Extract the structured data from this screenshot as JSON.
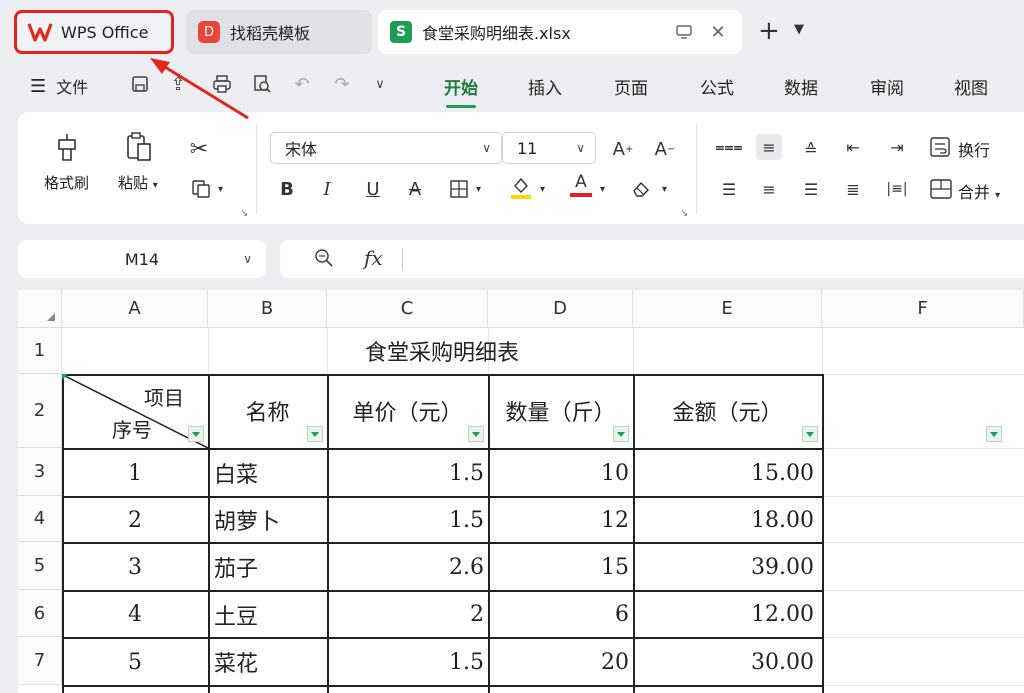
{
  "tabs": {
    "wps": "WPS Office",
    "template": "找稻壳模板",
    "document": "食堂采购明细表.xlsx",
    "template_icon_glyph": "D",
    "sheet_icon_glyph": "S"
  },
  "menu": {
    "file": "文件",
    "tabs": [
      "开始",
      "插入",
      "页面",
      "公式",
      "数据",
      "审阅",
      "视图"
    ],
    "active_tab": "开始"
  },
  "ribbon": {
    "format_painter": "格式刷",
    "paste": "粘贴",
    "font_name": "宋体",
    "font_size": "11",
    "wrap": "换行",
    "merge": "合并",
    "bold": "B",
    "italic": "I",
    "underline": "U",
    "strike": "A",
    "font_color_glyph": "A",
    "grow_font": "A+",
    "shrink_font": "A-"
  },
  "formula_bar": {
    "name_box": "M14",
    "fx": "fx"
  },
  "sheet": {
    "columns": [
      "A",
      "B",
      "C",
      "D",
      "E",
      "F"
    ],
    "rows": [
      "1",
      "2",
      "3",
      "4",
      "5",
      "6",
      "7"
    ],
    "title": "食堂采购明细表",
    "diag_top": "项目",
    "diag_bottom": "序号",
    "headers": [
      "名称",
      "单价（元）",
      "数量（斤）",
      "金额（元）"
    ],
    "data": [
      {
        "no": "1",
        "name": "白菜",
        "price": "1.5",
        "qty": "10",
        "amount": "15.00"
      },
      {
        "no": "2",
        "name": "胡萝卜",
        "price": "1.5",
        "qty": "12",
        "amount": "18.00"
      },
      {
        "no": "3",
        "name": "茄子",
        "price": "2.6",
        "qty": "15",
        "amount": "39.00"
      },
      {
        "no": "4",
        "name": "土豆",
        "price": "2",
        "qty": "6",
        "amount": "12.00"
      },
      {
        "no": "5",
        "name": "菜花",
        "price": "1.5",
        "qty": "20",
        "amount": "30.00"
      }
    ]
  },
  "colors": {
    "accent_green": "#1f9d55",
    "highlight_red": "#e2261c",
    "fill_yellow": "#f5d800",
    "font_red": "#e0202a"
  }
}
